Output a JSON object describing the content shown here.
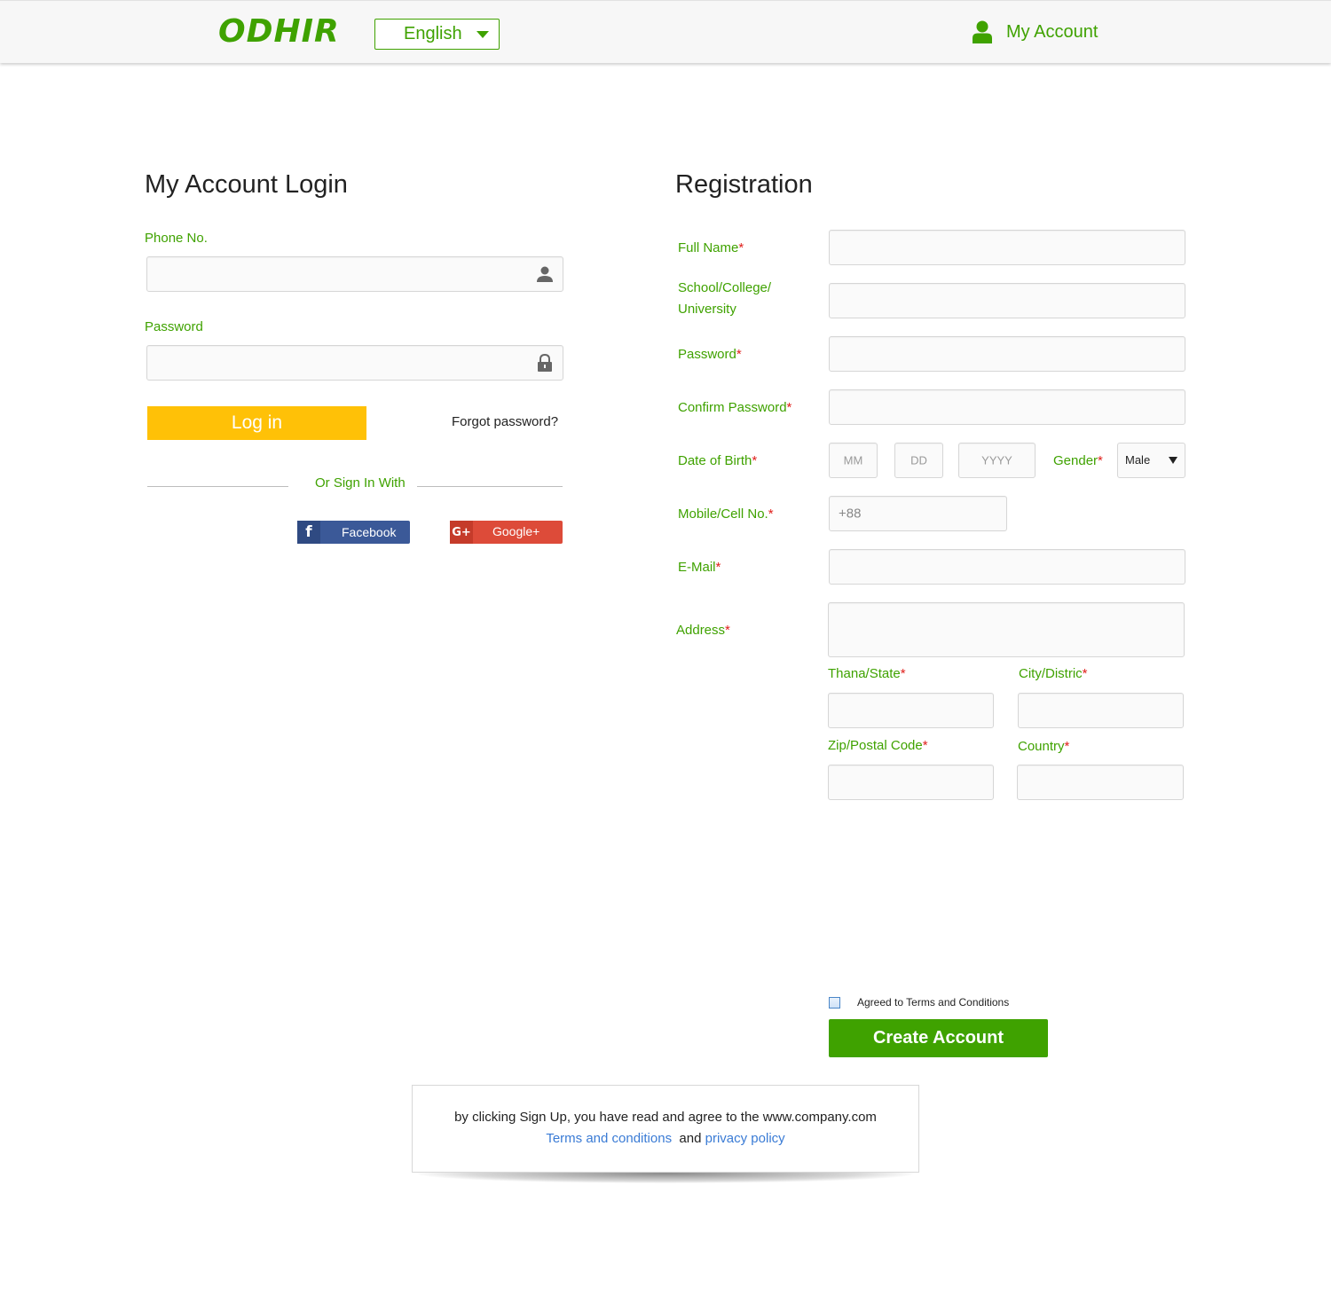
{
  "header": {
    "logo": "ODHIR",
    "language": "English",
    "account_label": "My Account"
  },
  "login": {
    "title": "My Account Login",
    "phone_label": "Phone No.",
    "password_label": "Password",
    "login_button": "Log in",
    "forgot_link": "Forgot password?",
    "or_sign_in": "Or Sign In With",
    "facebook_label": "Facebook",
    "google_label": "Google+"
  },
  "registration": {
    "title": "Registration",
    "full_name_label": "Full Name",
    "school_label_line1": "School/College/",
    "school_label_line2": "University",
    "password_label": "Password",
    "confirm_password_label": "Confirm Password",
    "dob_label": "Date of Birth",
    "dob_mm": "MM",
    "dob_dd": "DD",
    "dob_yyyy": "YYYY",
    "gender_label": "Gender",
    "gender_value": "Male",
    "mobile_label": "Mobile/Cell No.",
    "mobile_prefix": "+88",
    "email_label": "E-Mail",
    "address_label": "Address",
    "thana_label": "Thana/State",
    "city_label": "City/Distric",
    "zip_label": "Zip/Postal Code",
    "country_label": "Country",
    "required_mark": "*",
    "agree_label": "Agreed to Terms and Conditions",
    "create_button": "Create Account"
  },
  "notice": {
    "line1": "by clicking Sign Up, you have read and agree to the www.company.com",
    "terms_link": "Terms and conditions",
    "and_text": "and",
    "privacy_link": "privacy policy"
  },
  "colors": {
    "brand_green": "#3fa200",
    "login_yellow": "#ffc107",
    "required_red": "#e0201c",
    "facebook_blue": "#3b5998",
    "google_red": "#dd4b39",
    "link_blue": "#3a7bd5"
  }
}
